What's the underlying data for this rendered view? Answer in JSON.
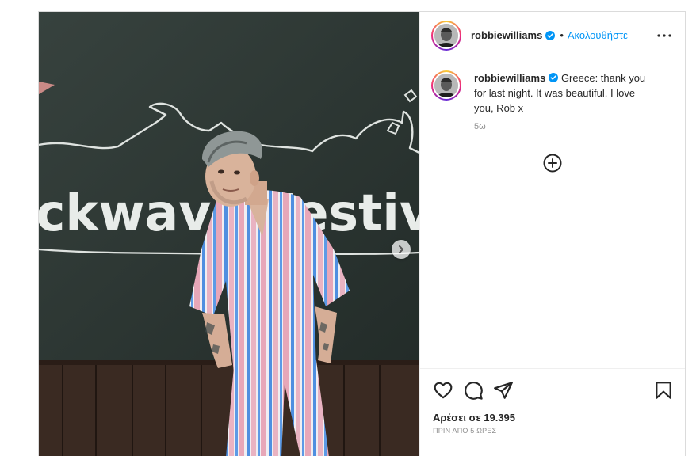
{
  "post": {
    "username": "robbiewilliams",
    "follow_label": "Ακολουθήστε",
    "separator": "•",
    "caption": "Greece: thank you for last night. It was beautiful. I love you, Rob x",
    "caption_time": "5ω",
    "likes_label": "Αρέσει σε 19.395",
    "time_ago": "ΠΡΙΝ ΑΠΟ 5 ΩΡΕΣ",
    "banner_text": "ckwave Festiv",
    "icons": [
      "verified-badge-icon",
      "more-options-icon",
      "add-circle-icon",
      "heart-icon",
      "comment-icon",
      "share-icon",
      "bookmark-icon",
      "chevron-right-icon"
    ],
    "colors": {
      "accent": "#0095f6",
      "text": "#262626",
      "muted": "#8e8e8e",
      "border": "#dbdbdb"
    }
  }
}
